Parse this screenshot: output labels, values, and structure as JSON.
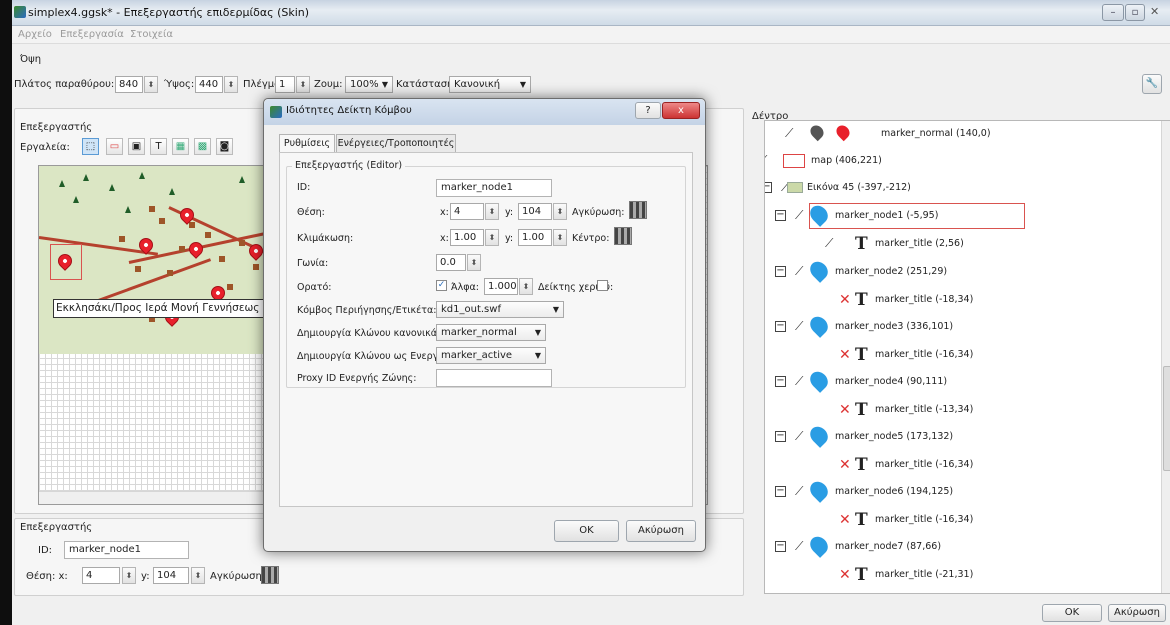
{
  "window": {
    "title": "simplex4.ggsk* - Επεξεργαστής επιδερμίδας (Skin)"
  },
  "menu": [
    "Αρχείο",
    "Επεξεργασία",
    "Στοιχεία"
  ],
  "view": {
    "section": "Όψη",
    "width_label": "Πλάτος παραθύρου:",
    "width_value": "840",
    "height_label": "Ύψος:",
    "height_value": "440",
    "grid_label": "Πλέγμα:",
    "grid_value": "1",
    "zoom_label": "Ζουμ:",
    "zoom_value": "100%",
    "mode_label": "Κατάσταση:",
    "mode_value": "Κανονική"
  },
  "editor_panel": {
    "section": "Επεξεργαστής",
    "tools_label": "Εργαλεία:",
    "tools": [
      "T"
    ],
    "map_caption": "Εκκλησάκι/Προς Ιερά Μονή Γεννήσεως Θεοτόκου"
  },
  "bottom_editor": {
    "section": "Επεξεργαστής",
    "id_label": "ID:",
    "id_value": "marker_node1",
    "pos_label": "Θέση: x:",
    "x_value": "4",
    "y_label": "y:",
    "y_value": "104",
    "anchor_label": "Αγκύρωση:"
  },
  "dialog": {
    "title": "Ιδιότητες Δείκτη Κόμβου",
    "help_btn": "?",
    "close_btn": "x",
    "tabs": [
      "Ρυθμίσεις",
      "Ενέργειες/Τροποποιητές"
    ],
    "group": "Επεξεργαστής (Editor)",
    "id_label": "ID:",
    "id_value": "marker_node1",
    "pos_label": "Θέση:",
    "pos_x_label": "x:",
    "pos_x": "4",
    "pos_y_label": "y:",
    "pos_y": "104",
    "anchor_label": "Αγκύρωση:",
    "scale_label": "Κλιμάκωση:",
    "scale_x_label": "x:",
    "scale_x": "1.00",
    "scale_y_label": "y:",
    "scale_y": "1.00",
    "center_label": "Κέντρο:",
    "angle_label": "Γωνία:",
    "angle_value": "0.0",
    "visible_label": "Ορατό:",
    "alpha_label": "Άλφα:",
    "alpha_value": "1.000",
    "hand_label": "Δείκτης χεριού:",
    "nav_label": "Κόμβος Περιήγησης/Ετικέτα:",
    "nav_value": "kd1_out.swf",
    "clone_normal_label": "Δημιουργία Κλώνου κανονικά:",
    "clone_normal_value": "marker_normal",
    "clone_active_label": "Δημιουργία Κλώνου ως Ενεργού:",
    "clone_active_value": "marker_active",
    "proxy_label": "Proxy ID Ενεργής Ζώνης:",
    "proxy_value": "",
    "ok": "OK",
    "cancel": "Ακύρωση"
  },
  "tree": {
    "section": "Δέντρο",
    "items": [
      {
        "label": "marker_normal (140,0)"
      },
      {
        "label": "map (406,221)"
      },
      {
        "label": "Εικόνα 45 (-397,-212)"
      },
      {
        "label": "marker_node1 (-5,95)"
      },
      {
        "label": "marker_title (2,56)"
      },
      {
        "label": "marker_node2 (251,29)"
      },
      {
        "label": "marker_title (-18,34)"
      },
      {
        "label": "marker_node3 (336,101)"
      },
      {
        "label": "marker_title (-16,34)"
      },
      {
        "label": "marker_node4 (90,111)"
      },
      {
        "label": "marker_title (-13,34)"
      },
      {
        "label": "marker_node5 (173,132)"
      },
      {
        "label": "marker_title (-16,34)"
      },
      {
        "label": "marker_node6 (194,125)"
      },
      {
        "label": "marker_title (-16,34)"
      },
      {
        "label": "marker_node7 (87,66)"
      },
      {
        "label": "marker_title (-21,31)"
      }
    ]
  },
  "footer": {
    "ok": "OK",
    "cancel": "Ακύρωση"
  },
  "colors": {
    "selection": "#d9534f",
    "marker_blue": "#2a9de4",
    "marker_red": "#e8202b"
  }
}
